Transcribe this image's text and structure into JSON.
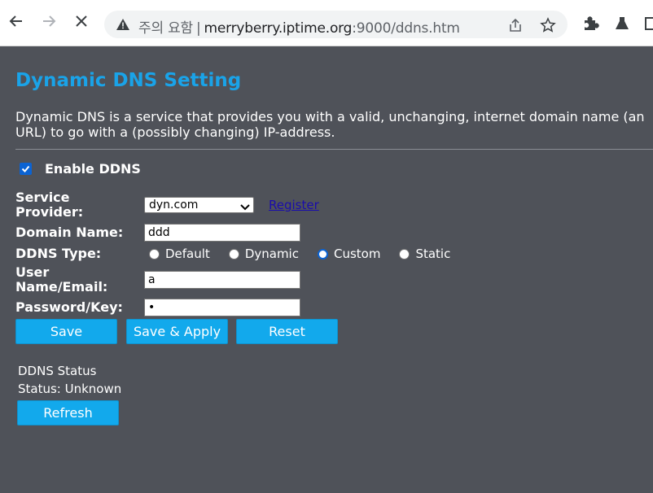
{
  "browser": {
    "security_label": "주의 요함",
    "url_host": "merryberry.iptime.org",
    "url_rest": ":9000/ddns.htm"
  },
  "page": {
    "title": "Dynamic DNS Setting",
    "description": "Dynamic DNS is a service that provides you with a valid, unchanging, internet domain name (an URL) to go with a (possibly changing) IP-address.",
    "enable_label": "Enable DDNS",
    "enable_checked": true,
    "service_provider_label": "Service Provider:",
    "service_provider_value": "dyn.com",
    "register_link": "Register",
    "domain_name_label": "Domain Name:",
    "domain_name_value": "ddd",
    "ddns_type_label": "DDNS Type:",
    "ddns_types": [
      {
        "label": "Default",
        "selected": false
      },
      {
        "label": "Dynamic",
        "selected": false
      },
      {
        "label": "Custom",
        "selected": true
      },
      {
        "label": "Static",
        "selected": false
      }
    ],
    "username_label": "User Name/Email:",
    "username_value": "a",
    "password_label": "Password/Key:",
    "password_value": "•",
    "buttons": {
      "save": "Save",
      "save_apply": "Save & Apply",
      "reset": "Reset"
    },
    "status_title": "DDNS Status",
    "status_text": "Status: Unknown",
    "refresh_label": "Refresh"
  },
  "colors": {
    "accent": "#1aa3e8",
    "button": "#12a9ec",
    "background": "#4f5259"
  }
}
